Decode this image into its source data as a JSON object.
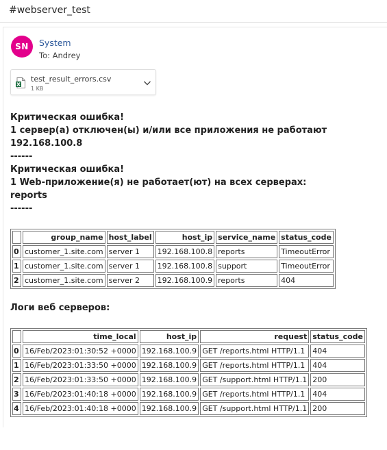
{
  "subject": "#webserver_test",
  "sender": {
    "initials": "SN",
    "avatar_color": "#e3008c",
    "name": "System",
    "to_line": "To:  Andrey"
  },
  "attachment": {
    "icon": "excel-file-icon",
    "name": "test_result_errors.csv",
    "size": "1 KB"
  },
  "alert_lines": [
    "Критическая ошибка!",
    "1 сервер(а) отключен(ы) и/или все приложения не работают",
    "192.168.100.8",
    "------",
    "Критическая ошибка!",
    "1 Web-приложение(я) не работает(ют) на всех серверах:",
    "reports",
    "------"
  ],
  "status_table": {
    "headers": [
      "",
      "group_name",
      "host_label",
      "host_ip",
      "service_name",
      "status_code"
    ],
    "rows": [
      [
        "0",
        "customer_1.site.com",
        "server 1",
        "192.168.100.8",
        "reports",
        "TimeoutError"
      ],
      [
        "1",
        "customer_1.site.com",
        "server 1",
        "192.168.100.8",
        "support",
        "TimeoutError"
      ],
      [
        "2",
        "customer_1.site.com",
        "server 2",
        "192.168.100.9",
        "reports",
        "404"
      ]
    ]
  },
  "logs_title": "Логи веб серверов:",
  "logs_table": {
    "headers": [
      "",
      "time_local",
      "host_ip",
      "request",
      "status_code"
    ],
    "rows": [
      [
        "0",
        "16/Feb/2023:01:30:52 +0000",
        "192.168.100.9",
        "GET /reports.html HTTP/1.1",
        "404"
      ],
      [
        "1",
        "16/Feb/2023:01:33:50 +0000",
        "192.168.100.9",
        "GET /reports.html HTTP/1.1",
        "404"
      ],
      [
        "2",
        "16/Feb/2023:01:33:50 +0000",
        "192.168.100.9",
        "GET /support.html HTTP/1.1",
        "200"
      ],
      [
        "3",
        "16/Feb/2023:01:40:18 +0000",
        "192.168.100.9",
        "GET /reports.html HTTP/1.1",
        "404"
      ],
      [
        "4",
        "16/Feb/2023:01:40:18 +0000",
        "192.168.100.9",
        "GET /support.html HTTP/1.1",
        "200"
      ]
    ]
  }
}
